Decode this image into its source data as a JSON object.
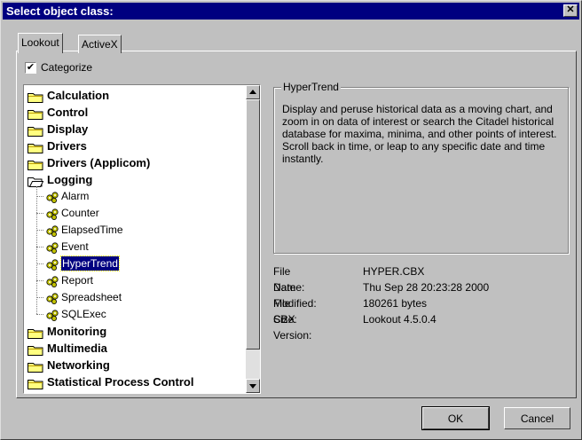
{
  "window": {
    "title": "Select object class:"
  },
  "tabs": [
    {
      "label": "Lookout"
    },
    {
      "label": "ActiveX"
    }
  ],
  "categorize": {
    "label": "Categorize",
    "checked": true
  },
  "tree": {
    "items": [
      {
        "label": "Calculation",
        "level": 0
      },
      {
        "label": "Control",
        "level": 0
      },
      {
        "label": "Display",
        "level": 0
      },
      {
        "label": "Drivers",
        "level": 0
      },
      {
        "label": "Drivers (Applicom)",
        "level": 0
      },
      {
        "label": "Logging",
        "level": 0,
        "expanded": true
      },
      {
        "label": "Alarm",
        "level": 1
      },
      {
        "label": "Counter",
        "level": 1
      },
      {
        "label": "ElapsedTime",
        "level": 1
      },
      {
        "label": "Event",
        "level": 1
      },
      {
        "label": "HyperTrend",
        "level": 1,
        "selected": true
      },
      {
        "label": "Report",
        "level": 1
      },
      {
        "label": "Spreadsheet",
        "level": 1
      },
      {
        "label": "SQLExec",
        "level": 1
      },
      {
        "label": "Monitoring",
        "level": 0
      },
      {
        "label": "Multimedia",
        "level": 0
      },
      {
        "label": "Networking",
        "level": 0
      },
      {
        "label": "Statistical Process Control",
        "level": 0
      }
    ]
  },
  "details": {
    "group_title": "HyperTrend",
    "description": "Display and peruse historical data as a moving chart, and zoom in on data of interest or search the Citadel historical database for maxima, minima, and other points of interest. Scroll back in time, or leap to any specific date and time instantly.",
    "fields": [
      {
        "key": "File Name:",
        "value": "HYPER.CBX"
      },
      {
        "key": "Date Modified:",
        "value": "Thu Sep 28 20:23:28 2000"
      },
      {
        "key": "File Size:",
        "value": "180261 bytes"
      },
      {
        "key": "CBX Version:",
        "value": "Lookout 4.5.0.4"
      }
    ]
  },
  "buttons": {
    "ok": "OK",
    "cancel": "Cancel"
  },
  "icons": {
    "close": "close-icon",
    "scroll_up": "up-arrow-icon",
    "scroll_down": "down-arrow-icon"
  }
}
